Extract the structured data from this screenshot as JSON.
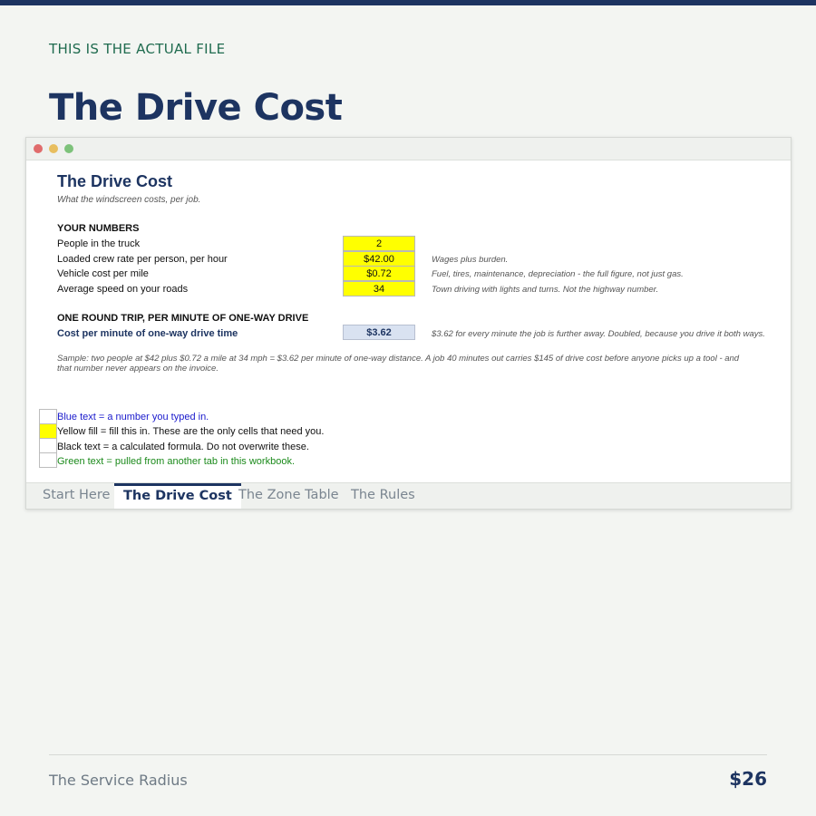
{
  "page": {
    "eyebrow": "THIS IS THE ACTUAL FILE",
    "title": "The Drive Cost",
    "footer_left": "The Service Radius",
    "footer_right": "$26"
  },
  "colors": {
    "brand_navy": "#1d3461",
    "eyebrow_green": "#1f6b4f",
    "input_yellow": "#ffff00",
    "result_blue": "#d9e2f1"
  },
  "sheet": {
    "title": "The Drive Cost",
    "subtitle": "What the windscreen costs, per job.",
    "inputs_heading": "YOUR NUMBERS",
    "inputs": [
      {
        "label": "People in the truck",
        "value": "2",
        "note": ""
      },
      {
        "label": "Loaded crew rate per person, per hour",
        "value": "$42.00",
        "note": "Wages plus burden."
      },
      {
        "label": "Vehicle cost per mile",
        "value": "$0.72",
        "note": "Fuel, tires, maintenance, depreciation - the full figure, not just gas."
      },
      {
        "label": "Average speed on your roads",
        "value": "34",
        "note": "Town driving with lights and turns. Not the highway number."
      }
    ],
    "result_heading": "ONE ROUND TRIP, PER MINUTE OF ONE-WAY DRIVE",
    "result": {
      "label": "Cost per minute of one-way drive time",
      "value": "$3.62",
      "note": "$3.62 for every minute the job is further away. Doubled, because you drive it both ways."
    },
    "sample": "Sample: two people at $42 plus $0.72 a mile at 34 mph = $3.62 per minute of one-way distance. A job 40 minutes out carries $145 of drive cost before anyone picks up a tool - and that number never appears on the invoice.",
    "legend": [
      {
        "text": "Blue text = a number you typed in.",
        "style": "blue"
      },
      {
        "text": "Yellow fill = fill this in. These are the only cells that need you.",
        "style": "yellow"
      },
      {
        "text": "Black text = a calculated formula. Do not overwrite these.",
        "style": "black"
      },
      {
        "text": "Green text = pulled from another tab in this workbook.",
        "style": "green"
      }
    ]
  },
  "tabs": [
    {
      "label": "Start Here",
      "active": false
    },
    {
      "label": "The Drive Cost",
      "active": true
    },
    {
      "label": "The Zone Table",
      "active": false
    },
    {
      "label": "The Rules",
      "active": false
    }
  ]
}
